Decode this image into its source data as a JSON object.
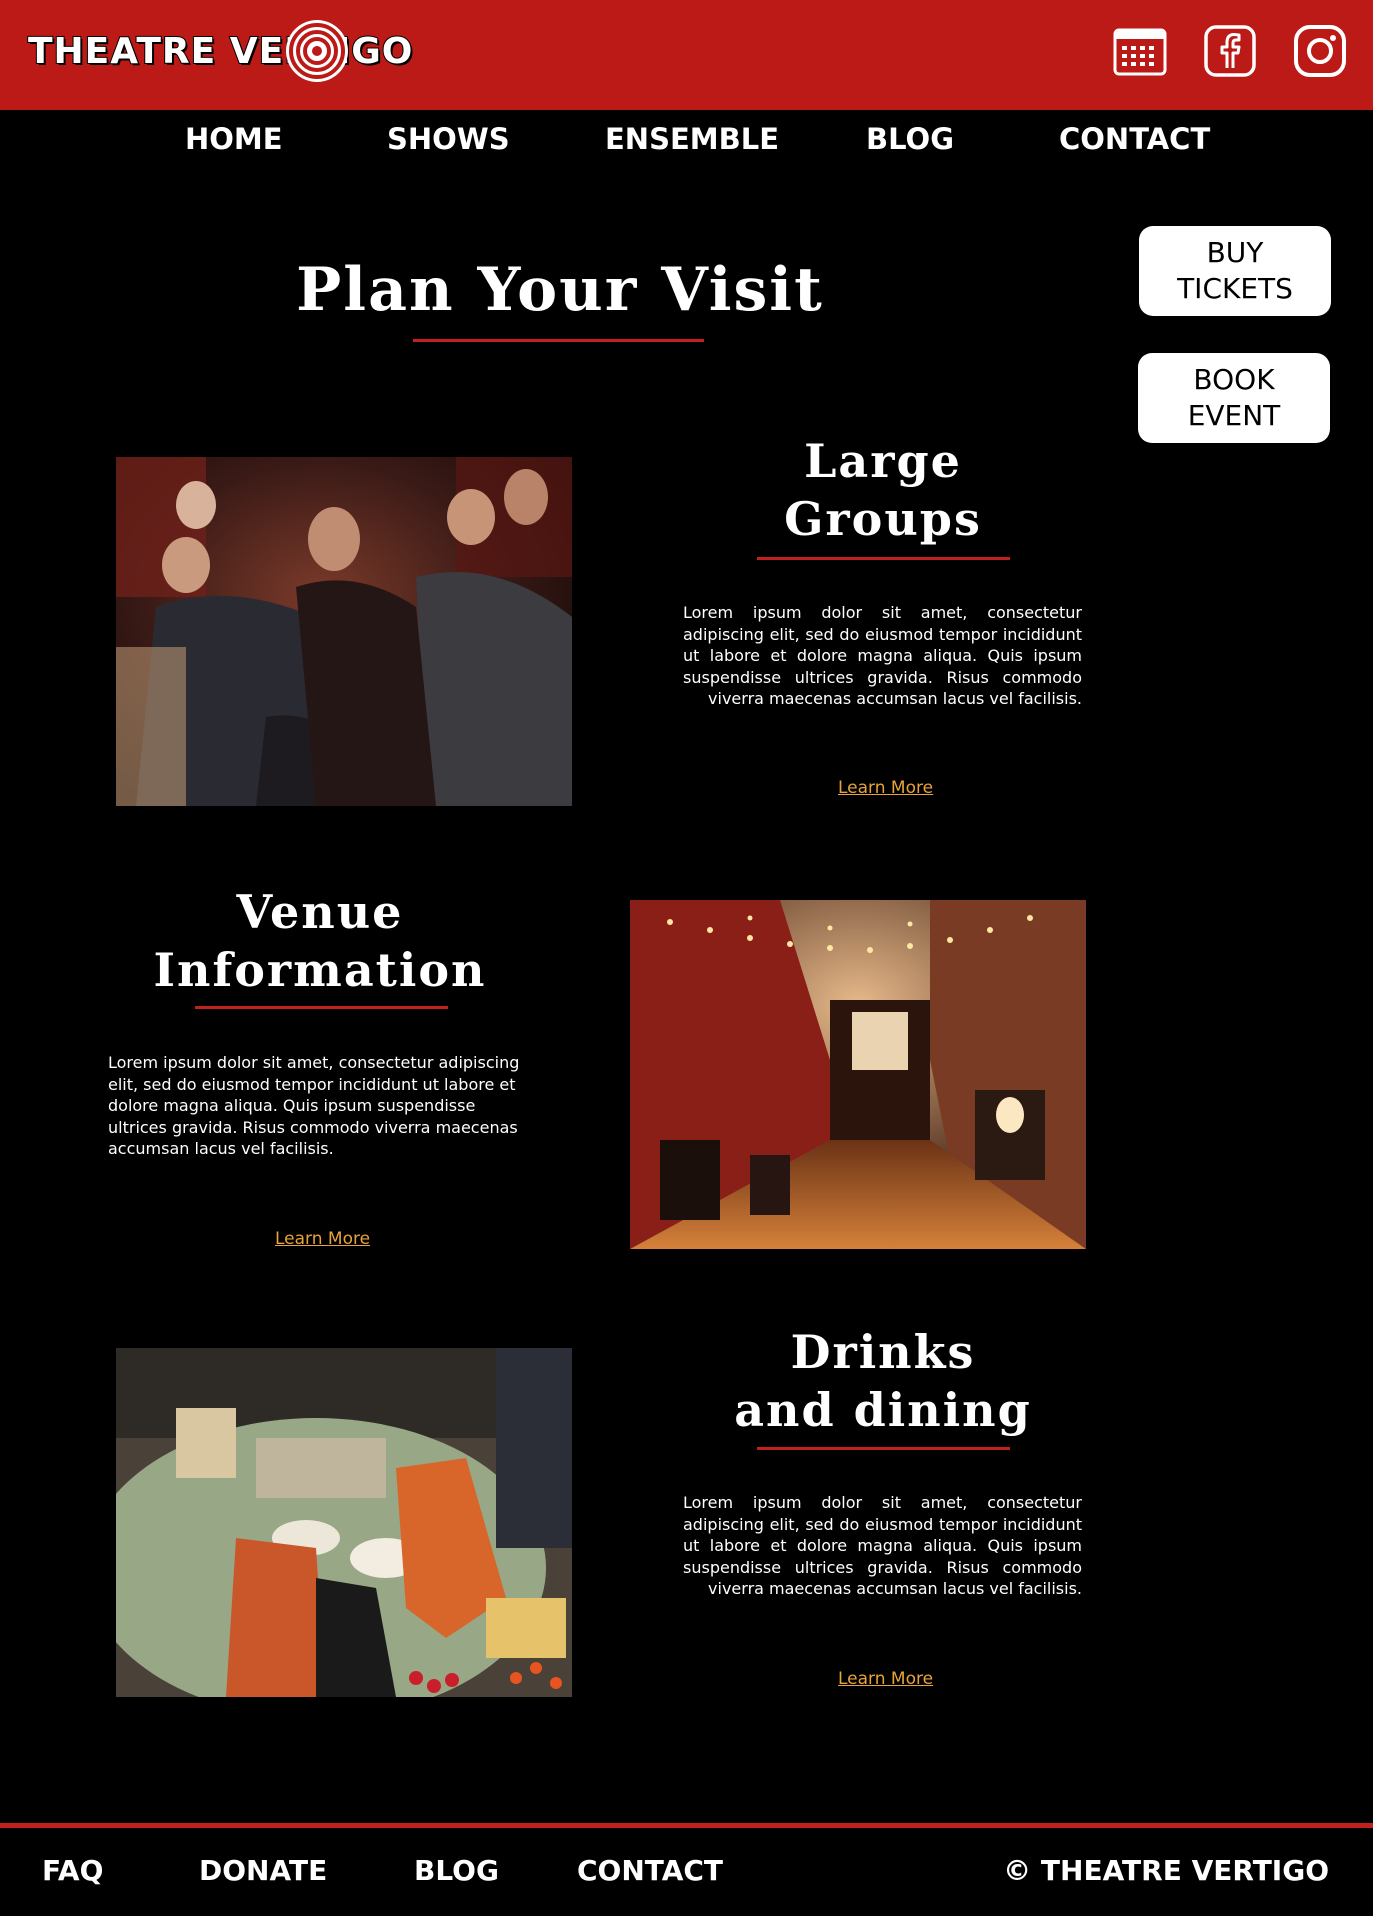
{
  "brand": {
    "name": "THEATRE VERTIGO"
  },
  "header": {
    "icons": [
      {
        "name": "calendar-icon"
      },
      {
        "name": "facebook-icon"
      },
      {
        "name": "instagram-icon"
      }
    ]
  },
  "nav": {
    "items": [
      "HOME",
      "SHOWS",
      "ENSEMBLE",
      "BLOG",
      "CONTACT"
    ]
  },
  "actions": {
    "buy_tickets": [
      "BUY",
      "TICKETS"
    ],
    "book_event": [
      "BOOK",
      "EVENT"
    ]
  },
  "page": {
    "title": "Plan Your Visit"
  },
  "sections": [
    {
      "title": [
        "Large",
        "Groups"
      ],
      "body": "Lorem ipsum dolor sit amet, consectetur adipiscing elit, sed do eiusmod tempor incididunt ut labore et dolore magna aliqua. Quis ipsum suspendisse ultrices gravida. Risus commodo viverra maecenas accumsan lacus vel facilisis.",
      "link": "Learn More"
    },
    {
      "title": [
        "Venue",
        "Information"
      ],
      "body": "Lorem ipsum dolor sit amet, consectetur adipiscing elit, sed do eiusmod tempor incididunt ut labore et dolore magna aliqua. Quis ipsum suspendisse ultrices gravida. Risus commodo viverra maecenas accumsan lacus vel facilisis.",
      "link": "Learn More"
    },
    {
      "title": [
        "Drinks",
        "and dining"
      ],
      "body": "Lorem ipsum dolor sit amet, consectetur adipiscing elit, sed do eiusmod tempor incididunt ut labore et dolore magna aliqua. Quis ipsum suspendisse ultrices gravida. Risus commodo viverra maecenas accumsan lacus vel facilisis.",
      "link": "Learn More"
    }
  ],
  "footer": {
    "items": [
      "FAQ",
      "DONATE",
      "BLOG",
      "CONTACT"
    ],
    "copyright": "© THEATRE VERTIGO"
  },
  "colors": {
    "brand_red": "#bb1a16",
    "accent_red": "#c0211d",
    "link": "#e8a33a",
    "background": "#000000"
  }
}
